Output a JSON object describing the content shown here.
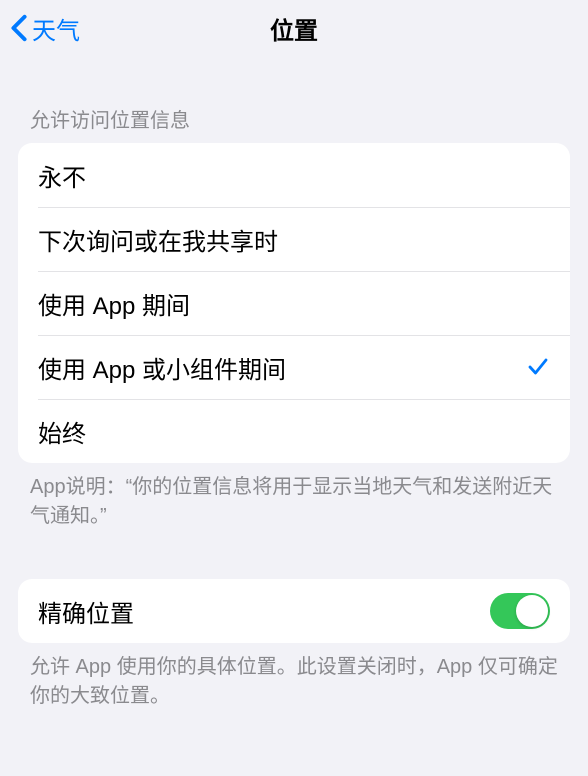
{
  "nav": {
    "back_label": "天气",
    "title": "位置"
  },
  "location_access": {
    "header": "允许访问位置信息",
    "options": [
      {
        "label": "永不",
        "selected": false
      },
      {
        "label": "下次询问或在我共享时",
        "selected": false
      },
      {
        "label": "使用 App 期间",
        "selected": false
      },
      {
        "label": "使用 App 或小组件期间",
        "selected": true
      },
      {
        "label": "始终",
        "selected": false
      }
    ],
    "footer": "App说明：“你的位置信息将用于显示当地天气和发送附近天气通知。”"
  },
  "precise_location": {
    "label": "精确位置",
    "enabled": true,
    "footer": "允许 App 使用你的具体位置。此设置关闭时，App 仅可确定你的大致位置。"
  }
}
